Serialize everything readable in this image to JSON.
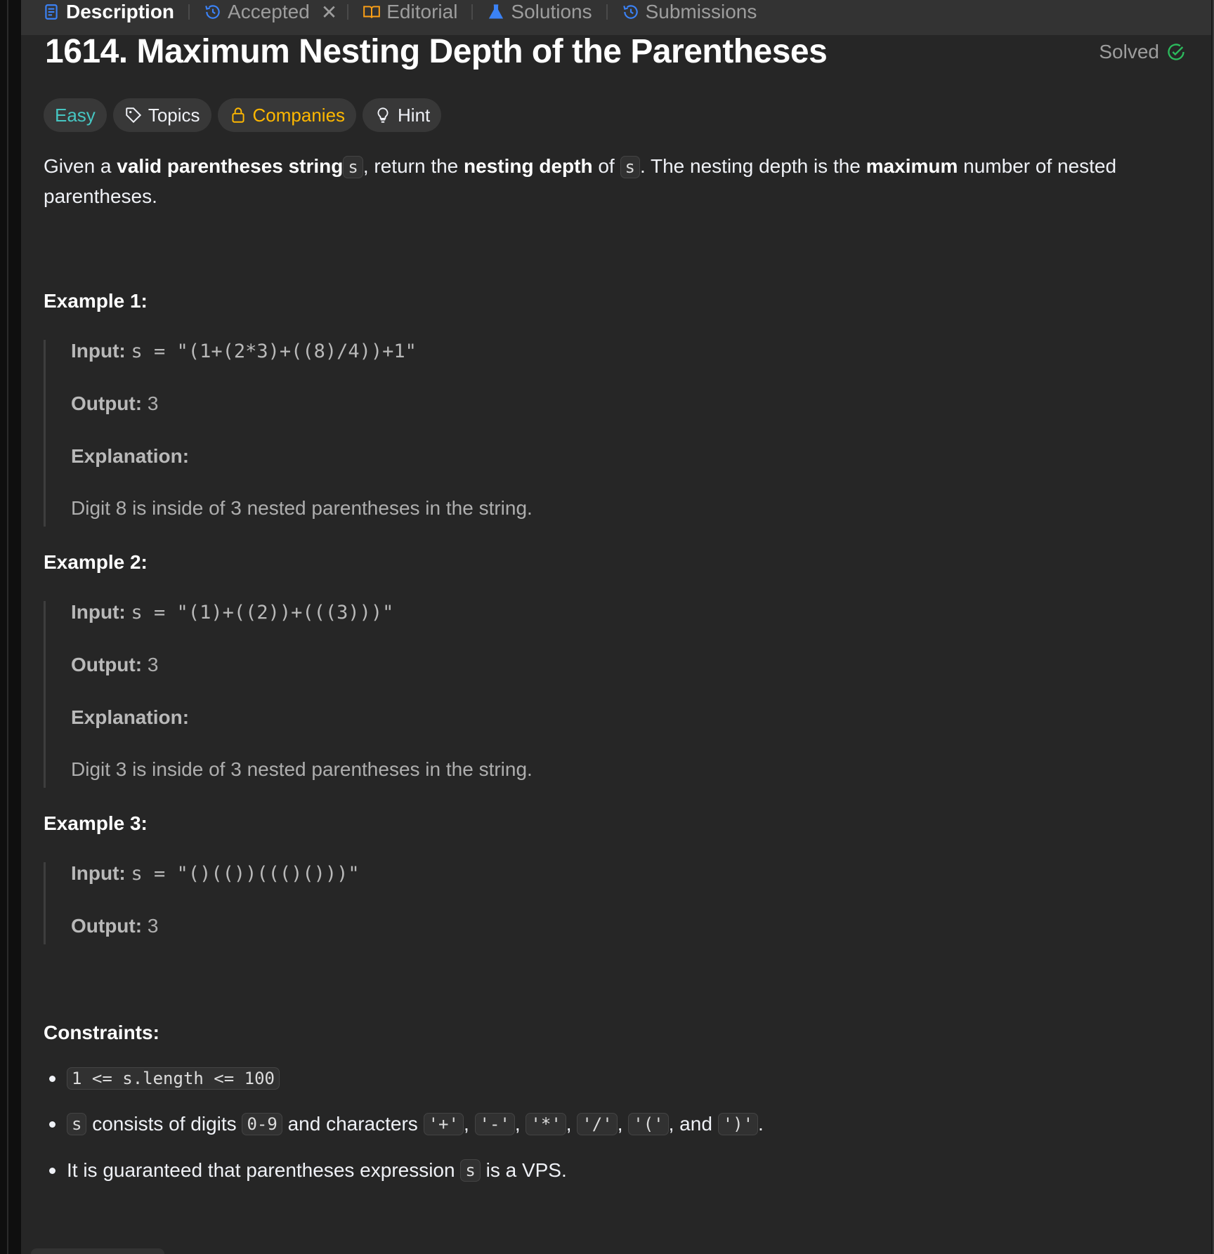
{
  "tabs": [
    {
      "label": "Description",
      "icon": "description-icon",
      "active": true
    },
    {
      "label": "Accepted",
      "icon": "history-icon"
    },
    {
      "label": "Editorial",
      "icon": "book-icon"
    },
    {
      "label": "Solutions",
      "icon": "flask-icon"
    },
    {
      "label": "Submissions",
      "icon": "history-icon"
    }
  ],
  "problem": {
    "title": "1614. Maximum Nesting Depth of the Parentheses",
    "status": "Solved",
    "status_color": "#2cbb5d",
    "chips": {
      "difficulty": "Easy",
      "topics": "Topics",
      "companies": "Companies",
      "hint": "Hint"
    },
    "description": {
      "t1": "Given a ",
      "b1": "valid parentheses string",
      "c1": "s",
      "t2": ", return the ",
      "b2": "nesting depth",
      "t3": " of ",
      "c2": "s",
      "t4": ". The nesting depth is the ",
      "b3": "maximum",
      "t5": " number of nested parentheses."
    }
  },
  "examples": [
    {
      "heading": "Example 1:",
      "input_label": "Input:",
      "input": "s = \"(1+(2*3)+((8)/4))+1\"",
      "output_label": "Output:",
      "output": "3",
      "explanation_label": "Explanation:",
      "explanation": "Digit 8 is inside of 3 nested parentheses in the string."
    },
    {
      "heading": "Example 2:",
      "input_label": "Input:",
      "input": "s = \"(1)+((2))+(((3)))\"",
      "output_label": "Output:",
      "output": "3",
      "explanation_label": "Explanation:",
      "explanation": "Digit 3 is inside of 3 nested parentheses in the string."
    },
    {
      "heading": "Example 3:",
      "input_label": "Input:",
      "input": "s = \"()(())((()()))\"",
      "output_label": "Output:",
      "output": "3"
    }
  ],
  "constraints": {
    "heading": "Constraints:",
    "c1": "1 <= s.length <= 100",
    "c2": {
      "s": "s",
      "t1": " consists of digits ",
      "digits": "0-9",
      "t2": " and characters ",
      "plus": "'+'",
      "minus": "'-'",
      "star": "'*'",
      "slash": "'/'",
      "lparen": "'('",
      "and": ", and ",
      "rparen": "')'",
      "sep": ", ",
      "end": "."
    },
    "c3": {
      "t1": "It is guaranteed that parentheses expression ",
      "s": "s",
      "t2": " is a VPS."
    }
  }
}
